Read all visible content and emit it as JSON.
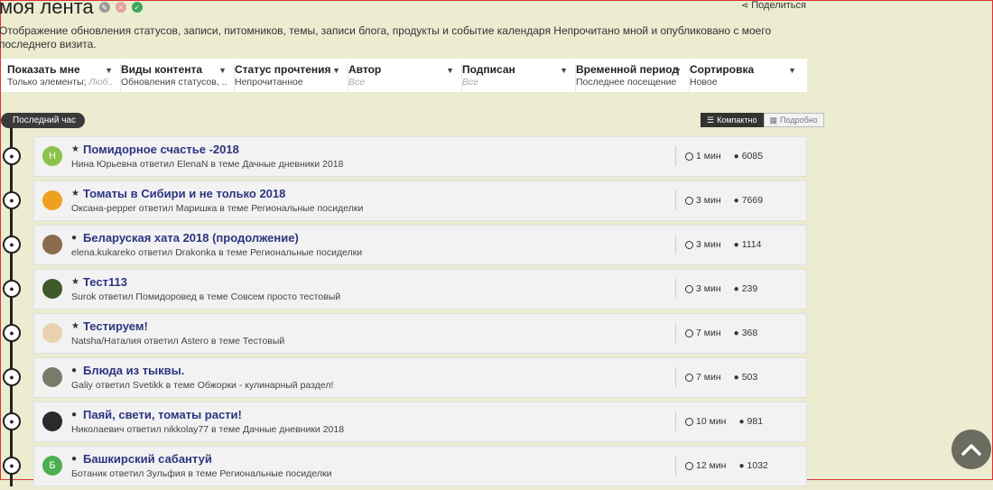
{
  "header": {
    "title": "моя лента",
    "share_label": "Поделиться",
    "description": "Отображение обновления статусов, записи, питомников, темы, записи блога, продукты и событие календаря Непрочитано мной и опубликовано с моего последнего визита."
  },
  "filters": [
    {
      "label": "Показать мне",
      "value": "Только элементы; ",
      "value_muted": "Люб...",
      "muted": false
    },
    {
      "label": "Виды контента",
      "value": "Обновления статусов, ...",
      "muted": false
    },
    {
      "label": "Статус прочтения",
      "value": "Непрочитанное",
      "muted": false
    },
    {
      "label": "Автор",
      "value": "Все",
      "muted": true
    },
    {
      "label": "Подписан",
      "value": "Все",
      "muted": true
    },
    {
      "label": "Временной период",
      "value": "Последнее посещение",
      "muted": false
    },
    {
      "label": "Сортировка",
      "value": "Новое",
      "muted": false
    }
  ],
  "timeline_label": "Последний час",
  "view_toggle": {
    "compact": "Компактно",
    "detailed": "Подробно"
  },
  "items": [
    {
      "avatar_letter": "Н",
      "avatar_color": "#8bc34a",
      "mark": "star",
      "title": "Помидорное счастье -2018",
      "meta": "Нина Юрьевна ответил ElenaN в теме Дачные дневники 2018",
      "time": "1 мин",
      "replies": "6085"
    },
    {
      "avatar_letter": "",
      "avatar_color": "#f0a020",
      "mark": "star",
      "title": "Томаты в Сибири и не только 2018",
      "meta": "Оксана-pepper ответил Маришка в теме Региональные посиделки",
      "time": "3 мин",
      "replies": "7669"
    },
    {
      "avatar_letter": "",
      "avatar_color": "#8a6d4f",
      "mark": "dot",
      "title": "Беларуская хата 2018 (продолжение)",
      "meta": "elena.kukareko ответил Drakonka в теме Региональные посиделки",
      "time": "3 мин",
      "replies": "1114"
    },
    {
      "avatar_letter": "",
      "avatar_color": "#3d5a2a",
      "mark": "star",
      "title": "Тест113",
      "meta": "Surok ответил Помидоровед в теме Совсем просто тестовый",
      "time": "3 мин",
      "replies": "239"
    },
    {
      "avatar_letter": "",
      "avatar_color": "#e8d2b0",
      "mark": "star",
      "title": "Тестируем!",
      "meta": "Natsha/Наталия ответил Astero в теме Тестовый",
      "time": "7 мин",
      "replies": "368"
    },
    {
      "avatar_letter": "",
      "avatar_color": "#7a7a6a",
      "mark": "dot",
      "title": "Блюда из тыквы.",
      "meta": "Galiy ответил Svetikk в теме Обжорки - кулинарный раздел!",
      "time": "7 мин",
      "replies": "503"
    },
    {
      "avatar_letter": "",
      "avatar_color": "#2a2a2a",
      "mark": "dot",
      "title": "Паяй, свети, томаты расти!",
      "meta": "Николаевич ответил nikkolay77 в теме Дачные дневники 2018",
      "time": "10 мин",
      "replies": "981"
    },
    {
      "avatar_letter": "Б",
      "avatar_color": "#4caf50",
      "mark": "dot",
      "title": "Башкирский сабантуй",
      "meta": "Ботаник ответил Зульфия в теме Региональные посиделки",
      "time": "12 мин",
      "replies": "1032"
    }
  ]
}
